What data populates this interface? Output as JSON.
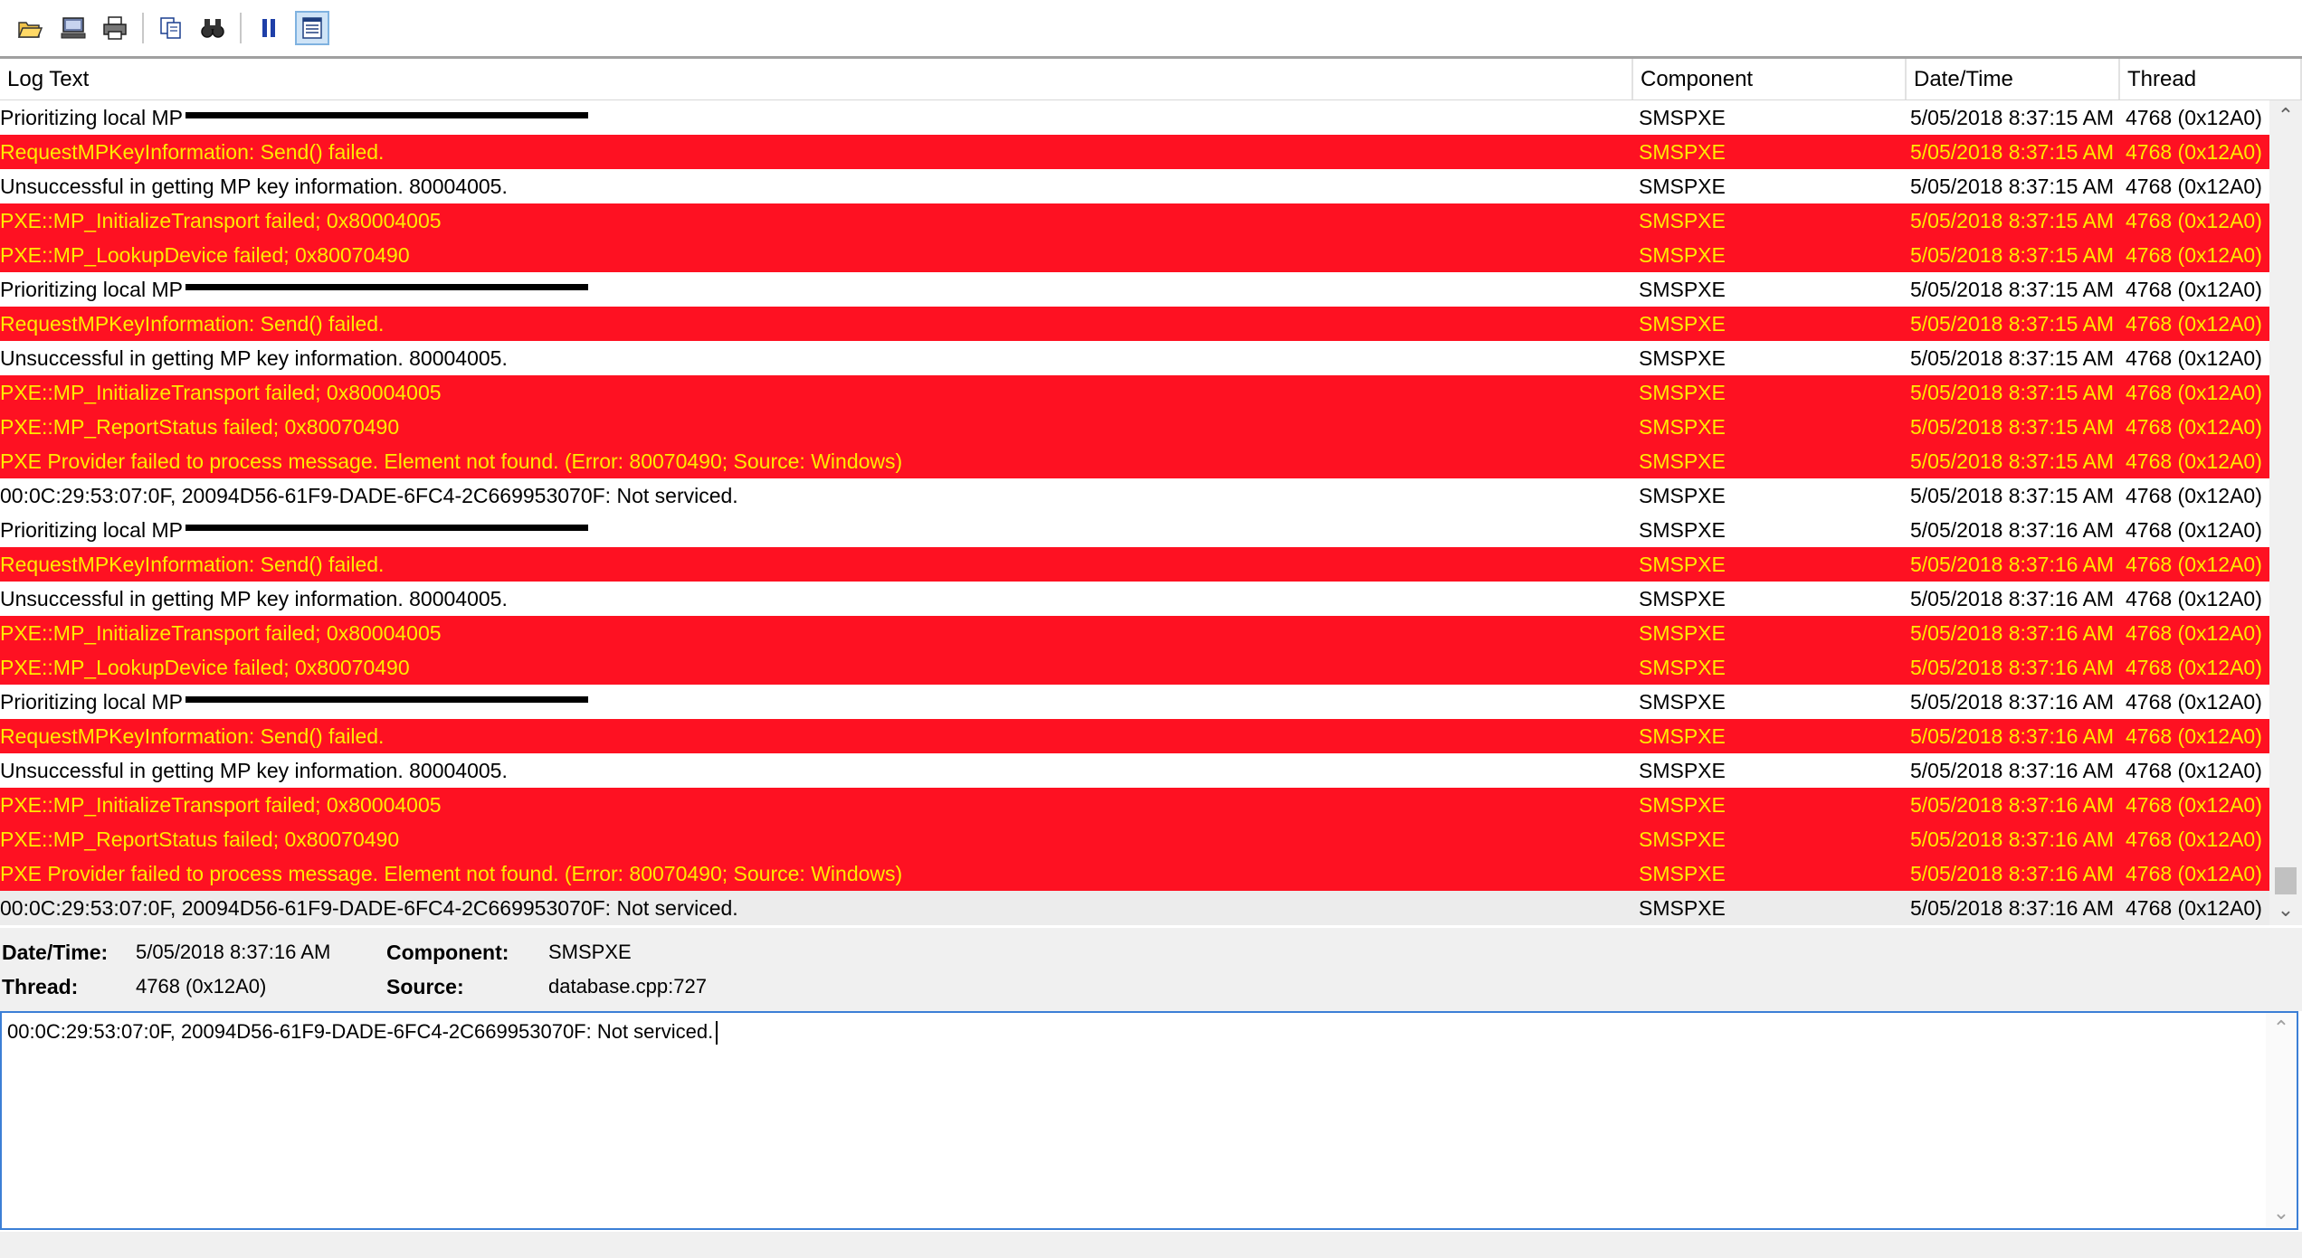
{
  "toolbar": {
    "buttons": [
      {
        "icon": "open-folder-icon"
      },
      {
        "icon": "open-remote-icon"
      },
      {
        "icon": "print-icon"
      },
      {
        "icon": "copy-icon"
      },
      {
        "icon": "find-icon"
      },
      {
        "icon": "pause-icon"
      },
      {
        "icon": "highlight-icon",
        "active": true
      }
    ]
  },
  "columns": {
    "log_text": "Log Text",
    "component": "Component",
    "datetime": "Date/Time",
    "thread": "Thread"
  },
  "rows": [
    {
      "text": "Prioritizing local MP ",
      "redacted": true,
      "component": "SMSPXE",
      "datetime": "5/05/2018 8:37:15 AM",
      "thread": "4768 (0x12A0)",
      "error": false
    },
    {
      "text": "RequestMPKeyInformation: Send() failed.",
      "component": "SMSPXE",
      "datetime": "5/05/2018 8:37:15 AM",
      "thread": "4768 (0x12A0)",
      "error": true
    },
    {
      "text": "Unsuccessful in getting MP key information. 80004005.",
      "component": "SMSPXE",
      "datetime": "5/05/2018 8:37:15 AM",
      "thread": "4768 (0x12A0)",
      "error": false
    },
    {
      "text": "PXE::MP_InitializeTransport failed; 0x80004005",
      "component": "SMSPXE",
      "datetime": "5/05/2018 8:37:15 AM",
      "thread": "4768 (0x12A0)",
      "error": true
    },
    {
      "text": "PXE::MP_LookupDevice failed; 0x80070490",
      "component": "SMSPXE",
      "datetime": "5/05/2018 8:37:15 AM",
      "thread": "4768 (0x12A0)",
      "error": true
    },
    {
      "text": "Prioritizing local MP ",
      "redacted": true,
      "component": "SMSPXE",
      "datetime": "5/05/2018 8:37:15 AM",
      "thread": "4768 (0x12A0)",
      "error": false
    },
    {
      "text": "RequestMPKeyInformation: Send() failed.",
      "component": "SMSPXE",
      "datetime": "5/05/2018 8:37:15 AM",
      "thread": "4768 (0x12A0)",
      "error": true
    },
    {
      "text": "Unsuccessful in getting MP key information. 80004005.",
      "component": "SMSPXE",
      "datetime": "5/05/2018 8:37:15 AM",
      "thread": "4768 (0x12A0)",
      "error": false
    },
    {
      "text": "PXE::MP_InitializeTransport failed; 0x80004005",
      "component": "SMSPXE",
      "datetime": "5/05/2018 8:37:15 AM",
      "thread": "4768 (0x12A0)",
      "error": true
    },
    {
      "text": "PXE::MP_ReportStatus failed; 0x80070490",
      "component": "SMSPXE",
      "datetime": "5/05/2018 8:37:15 AM",
      "thread": "4768 (0x12A0)",
      "error": true
    },
    {
      "text": "PXE Provider failed to process message. Element not found. (Error: 80070490; Source: Windows)",
      "component": "SMSPXE",
      "datetime": "5/05/2018 8:37:15 AM",
      "thread": "4768 (0x12A0)",
      "error": true
    },
    {
      "text": "00:0C:29:53:07:0F, 20094D56-61F9-DADE-6FC4-2C669953070F: Not serviced.",
      "component": "SMSPXE",
      "datetime": "5/05/2018 8:37:15 AM",
      "thread": "4768 (0x12A0)",
      "error": false
    },
    {
      "text": "Prioritizing local MP ",
      "redacted": true,
      "component": "SMSPXE",
      "datetime": "5/05/2018 8:37:16 AM",
      "thread": "4768 (0x12A0)",
      "error": false
    },
    {
      "text": "RequestMPKeyInformation: Send() failed.",
      "component": "SMSPXE",
      "datetime": "5/05/2018 8:37:16 AM",
      "thread": "4768 (0x12A0)",
      "error": true
    },
    {
      "text": "Unsuccessful in getting MP key information. 80004005.",
      "component": "SMSPXE",
      "datetime": "5/05/2018 8:37:16 AM",
      "thread": "4768 (0x12A0)",
      "error": false
    },
    {
      "text": "PXE::MP_InitializeTransport failed; 0x80004005",
      "component": "SMSPXE",
      "datetime": "5/05/2018 8:37:16 AM",
      "thread": "4768 (0x12A0)",
      "error": true
    },
    {
      "text": "PXE::MP_LookupDevice failed; 0x80070490",
      "component": "SMSPXE",
      "datetime": "5/05/2018 8:37:16 AM",
      "thread": "4768 (0x12A0)",
      "error": true
    },
    {
      "text": "Prioritizing local MP ",
      "redacted": true,
      "component": "SMSPXE",
      "datetime": "5/05/2018 8:37:16 AM",
      "thread": "4768 (0x12A0)",
      "error": false
    },
    {
      "text": "RequestMPKeyInformation: Send() failed.",
      "component": "SMSPXE",
      "datetime": "5/05/2018 8:37:16 AM",
      "thread": "4768 (0x12A0)",
      "error": true
    },
    {
      "text": "Unsuccessful in getting MP key information. 80004005.",
      "component": "SMSPXE",
      "datetime": "5/05/2018 8:37:16 AM",
      "thread": "4768 (0x12A0)",
      "error": false
    },
    {
      "text": "PXE::MP_InitializeTransport failed; 0x80004005",
      "component": "SMSPXE",
      "datetime": "5/05/2018 8:37:16 AM",
      "thread": "4768 (0x12A0)",
      "error": true
    },
    {
      "text": "PXE::MP_ReportStatus failed; 0x80070490",
      "component": "SMSPXE",
      "datetime": "5/05/2018 8:37:16 AM",
      "thread": "4768 (0x12A0)",
      "error": true
    },
    {
      "text": "PXE Provider failed to process message. Element not found. (Error: 80070490; Source: Windows)",
      "component": "SMSPXE",
      "datetime": "5/05/2018 8:37:16 AM",
      "thread": "4768 (0x12A0)",
      "error": true
    },
    {
      "text": "00:0C:29:53:07:0F, 20094D56-61F9-DADE-6FC4-2C669953070F: Not serviced.",
      "component": "SMSPXE",
      "datetime": "5/05/2018 8:37:16 AM",
      "thread": "4768 (0x12A0)",
      "error": false,
      "selected": true
    }
  ],
  "colors": {
    "error_row_bg": "#fe1122",
    "error_row_text": "#ffea00",
    "selection_border": "#3c7fd6"
  },
  "details": {
    "datetime_label": "Date/Time:",
    "datetime_value": "5/05/2018 8:37:16 AM",
    "component_label": "Component:",
    "component_value": "SMSPXE",
    "thread_label": "Thread:",
    "thread_value": "4768 (0x12A0)",
    "source_label": "Source:",
    "source_value": "database.cpp:727"
  },
  "message": {
    "text": "00:0C:29:53:07:0F, 20094D56-61F9-DADE-6FC4-2C669953070F: Not serviced."
  }
}
